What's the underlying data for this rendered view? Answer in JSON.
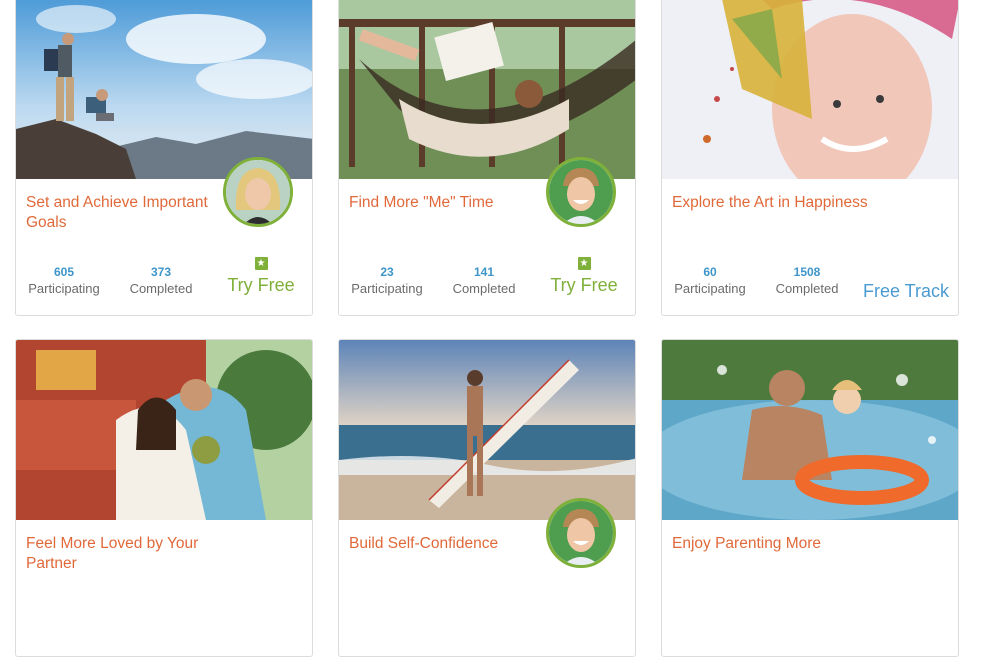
{
  "cards": [
    {
      "title": "Set and Achieve Important Goals",
      "participating_count": "605",
      "participating_label": "Participating",
      "completed_count": "373",
      "completed_label": "Completed",
      "action_label": "Try Free",
      "action_icon": "star-badge-icon",
      "has_avatar": true
    },
    {
      "title": "Find More \"Me\" Time",
      "participating_count": "23",
      "participating_label": "Participating",
      "completed_count": "141",
      "completed_label": "Completed",
      "action_label": "Try Free",
      "action_icon": "star-badge-icon",
      "has_avatar": true
    },
    {
      "title": "Explore the Art in Happiness",
      "participating_count": "60",
      "participating_label": "Participating",
      "completed_count": "1508",
      "completed_label": "Completed",
      "action_label": "Free Track",
      "has_avatar": false
    },
    {
      "title": "Feel More Loved by Your Partner",
      "has_avatar": false
    },
    {
      "title": "Build Self-Confidence",
      "has_avatar": true
    },
    {
      "title": "Enjoy Parenting More",
      "has_avatar": false
    }
  ],
  "colors": {
    "title": "#e0693a",
    "count": "#3d95c9",
    "label": "#6b6b6b",
    "try_free": "#7fb03a",
    "free_track": "#4a9bd1",
    "border": "#dcdcdc"
  }
}
